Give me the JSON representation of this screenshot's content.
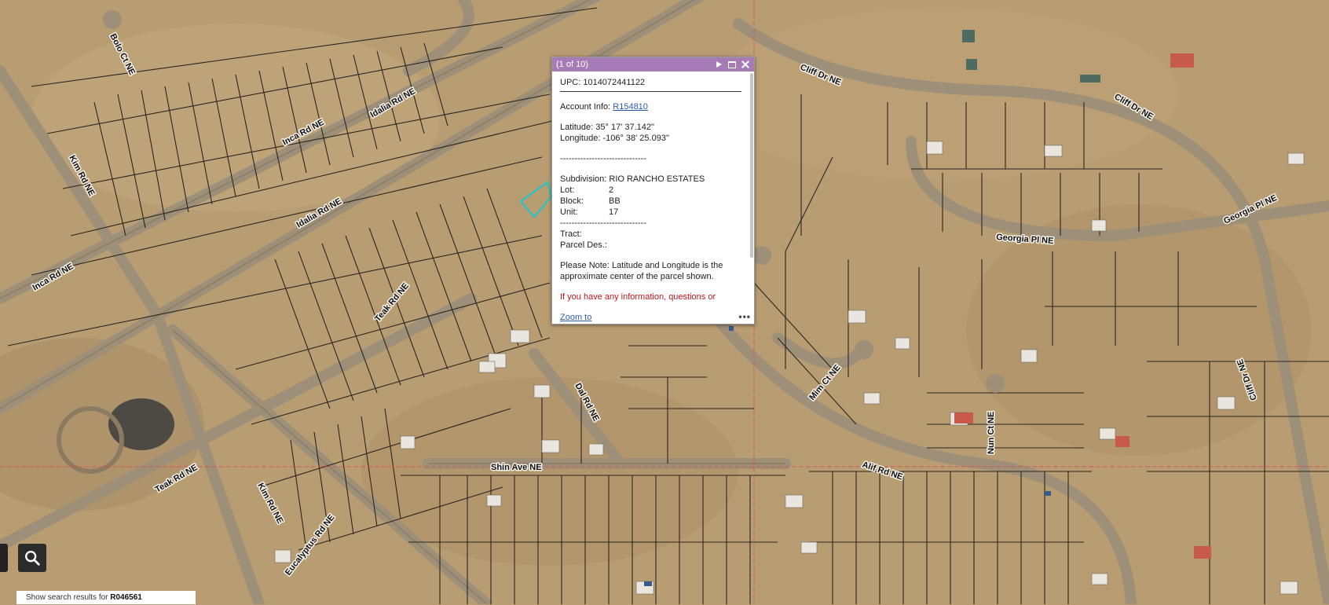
{
  "map": {
    "road_labels": [
      "Bolo Ct NE",
      "Idalia Rd NE",
      "Inca Rd NE",
      "Kim Rd NE",
      "Idalia Rd NE",
      "Inca Rd NE",
      "Teak Rd NE",
      "Dal Rd NE",
      "Cliff Dr NE",
      "Cliff Dr NE",
      "Georgia Pl NE",
      "Georgia Pl NE",
      "Mim Ct NE",
      "Nun Ct NE",
      "Alif Rd NE",
      "Shin Ave NE",
      "Teak Rd NE",
      "Kim Rd NE",
      "Eucalyptus Rd NE",
      "Cliff Dr NE"
    ],
    "colors": {
      "terrain": "#b89c72",
      "parcel_line": "#2a2620",
      "road": "#9d8f78",
      "selected_parcel": "#19c8c8",
      "grid_line": "#e34b4b"
    }
  },
  "popup": {
    "counter": "(1 of 10)",
    "header_color": "#a77bb5",
    "upc": "UPC: 1014072441122",
    "account_label": "Account Info: ",
    "account_link": "R154810",
    "latitude": "Latitude: 35° 17' 37.142\"",
    "longitude": "Longitude: -106° 38' 25.093\"",
    "separator1": "------------------------------",
    "subdivision": "Subdivision: RIO RANCHO ESTATES",
    "lot_label": "Lot:",
    "lot_value": "2",
    "block_label": "Block:",
    "block_value": "BB",
    "unit_label": "Unit:",
    "unit_value": "17",
    "separator2": "------------------------------",
    "tract": "Tract:",
    "parcel_des": "Parcel Des.:",
    "note_line1": "Please Note: Latitude and Longitude is the",
    "note_line2": "approximate center of the parcel shown.",
    "info_red": "If you have any information, questions or",
    "zoom_to": "Zoom to",
    "more": "•••"
  },
  "search": {
    "results_prefix": "Show search results for ",
    "results_term": "R046561"
  }
}
